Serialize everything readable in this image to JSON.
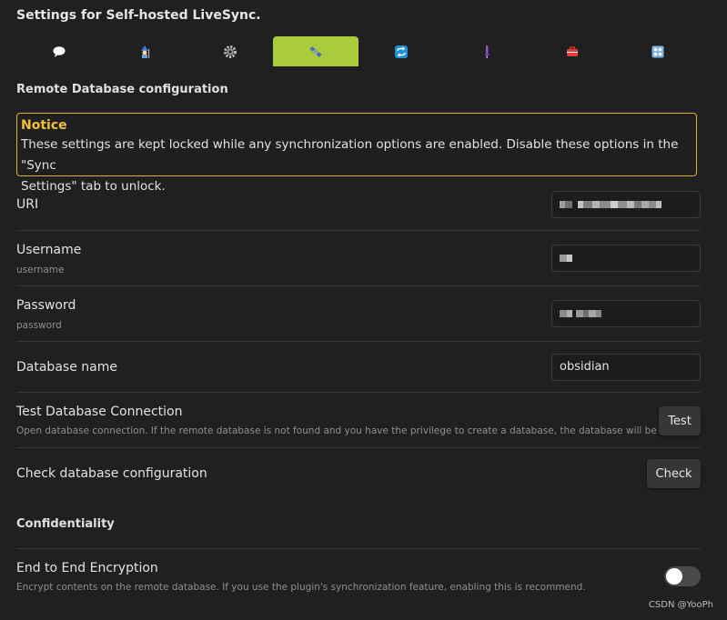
{
  "title": "Settings for Self-hosted LiveSync.",
  "tabs": [
    {
      "icon": "speech-bubble-icon",
      "active": false
    },
    {
      "icon": "wizard-icon",
      "active": false
    },
    {
      "icon": "gear-icon",
      "active": false
    },
    {
      "icon": "satellite-icon",
      "active": true
    },
    {
      "icon": "sync-arrows-icon",
      "active": false
    },
    {
      "icon": "microscope-icon",
      "active": false
    },
    {
      "icon": "toolbox-icon",
      "active": false
    },
    {
      "icon": "control-knobs-icon",
      "active": false
    }
  ],
  "remote_section": {
    "heading": "Remote Database configuration"
  },
  "notice": {
    "title": "Notice",
    "text_line1": "These settings are kept locked while any synchronization options are enabled. Disable these options in the \"Sync",
    "text_line2": "Settings\" tab to unlock."
  },
  "fields": {
    "uri": {
      "name": "URI",
      "value": "(blurred)"
    },
    "username": {
      "name": "Username",
      "desc": "username",
      "value": "(blurred)"
    },
    "password": {
      "name": "Password",
      "desc": "password",
      "value": "(blurred)"
    },
    "database_name": {
      "name": "Database name",
      "value": "obsidian"
    }
  },
  "test_connection": {
    "name": "Test Database Connection",
    "desc": "Open database connection. If the remote database is not found and you have the privilege to create a database, the database will be created.",
    "button": "Test"
  },
  "check_config": {
    "name": "Check database configuration",
    "button": "Check"
  },
  "confidentiality": {
    "heading": "Confidentiality"
  },
  "e2ee": {
    "name": "End to End Encryption",
    "desc": "Encrypt contents on the remote database. If you use the plugin's synchronization feature, enabling this is recommend.",
    "enabled": false
  },
  "watermark": "CSDN @YooPh",
  "colors": {
    "accent": "#a8cc3c",
    "notice_border": "#e0b13a",
    "notice_title": "#f2c038",
    "background": "#202020"
  }
}
